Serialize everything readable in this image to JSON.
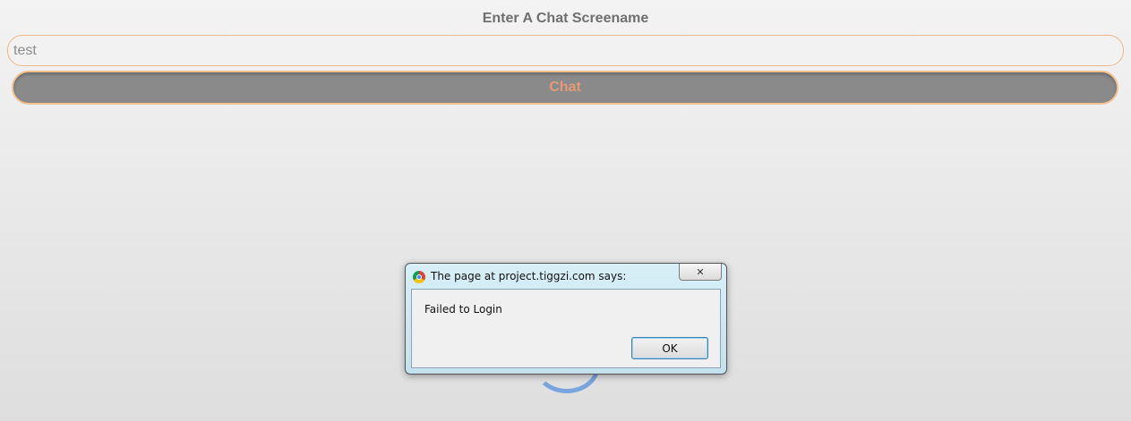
{
  "page": {
    "heading": "Enter A Chat Screename",
    "screenname_value": "test",
    "chat_button_label": "Chat"
  },
  "dialog": {
    "title": "The page at project.tiggzi.com says:",
    "message": "Failed to Login",
    "ok_label": "OK",
    "close_glyph": "✕"
  },
  "icons": {
    "browser_icon": "chrome-icon",
    "close_icon": "close-icon",
    "loading": "loading-spinner"
  },
  "colors": {
    "button_bg": "#8a8a8a",
    "button_text": "#e39a7a",
    "accent_border": "#f1c08e",
    "dialog_frame": "#c4e1ee"
  }
}
